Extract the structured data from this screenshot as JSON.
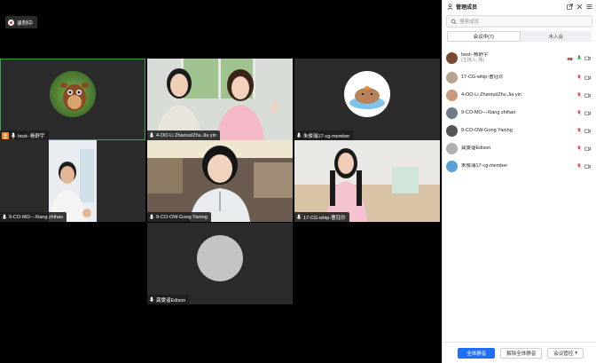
{
  "recording": {
    "label": "录制中"
  },
  "tiles": [
    {
      "name": "host--杨舒宇",
      "role": "host"
    },
    {
      "name": "4-OO-Li Zhaorui/Zhu Jia yin"
    },
    {
      "name": "朱俊瑞17-cg-member"
    },
    {
      "name": "9-CO-MO---Xiang zhihao"
    },
    {
      "name": "9-CO-OW-Gong Yaning"
    },
    {
      "name": "17-CG-whip-曹钰珍"
    },
    {
      "name": "龚雯谣Edison"
    }
  ],
  "panel": {
    "title": "管理成员",
    "search_placeholder": "搜索成员",
    "tabs": {
      "in_meeting": "会议中(7)",
      "not_joined": "未入会"
    },
    "members": [
      {
        "name": "host--杨舒宇",
        "sub": "(主持人, 我)",
        "avatar_color": "#7a4a2f"
      },
      {
        "name": "17-CG-whip-曹钰珍",
        "avatar_color": "#b9a58f"
      },
      {
        "name": "4-OO-Li Zhaorui/Zhu Jia yin",
        "avatar_color": "#c99a7e"
      },
      {
        "name": "9-CO-MO---Xiang zhihao",
        "avatar_color": "#6e7c8a"
      },
      {
        "name": "9-CO-OW-Gong Yaning",
        "avatar_color": "#555555"
      },
      {
        "name": "龚雯谣Edison",
        "avatar_color": "#b0b0b0"
      },
      {
        "name": "朱俊瑞17-cg-member",
        "avatar_color": "#5aa0d8"
      }
    ],
    "footer": {
      "mute_all": "全体静音",
      "unmute_all": "解除全体静音",
      "controls": "会议管控"
    }
  },
  "colors": {
    "active_speaker": "#3fa34d",
    "primary": "#1f6ef5",
    "host_badge": "#f08a24"
  }
}
